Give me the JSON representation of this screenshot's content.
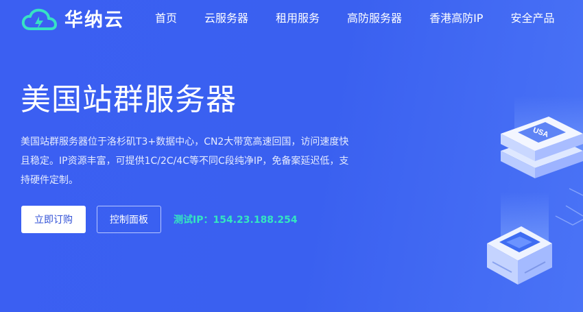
{
  "brand": {
    "name": "华纳云"
  },
  "nav": {
    "items": [
      {
        "label": "首页"
      },
      {
        "label": "云服务器"
      },
      {
        "label": "租用服务"
      },
      {
        "label": "高防服务器"
      },
      {
        "label": "香港高防IP"
      },
      {
        "label": "安全产品"
      }
    ]
  },
  "hero": {
    "title": "美国站群服务器",
    "description": "美国站群服务器位于洛杉矶T3+数据中心，CN2大带宽高速回国，访问速度快且稳定。IP资源丰富，可提供1C/2C/4C等不同C段纯净IP，免备案延迟低，支持硬件定制。",
    "buy_button": "立即订购",
    "console_button": "控制面板",
    "test_ip_label": "测试IP：",
    "test_ip_value": "154.23.188.254"
  },
  "illustration": {
    "badge_text": "USA"
  },
  "colors": {
    "background": "#3a5ff0",
    "accent_ip": "#33e6c0",
    "button_text": "#2f4fd6"
  }
}
